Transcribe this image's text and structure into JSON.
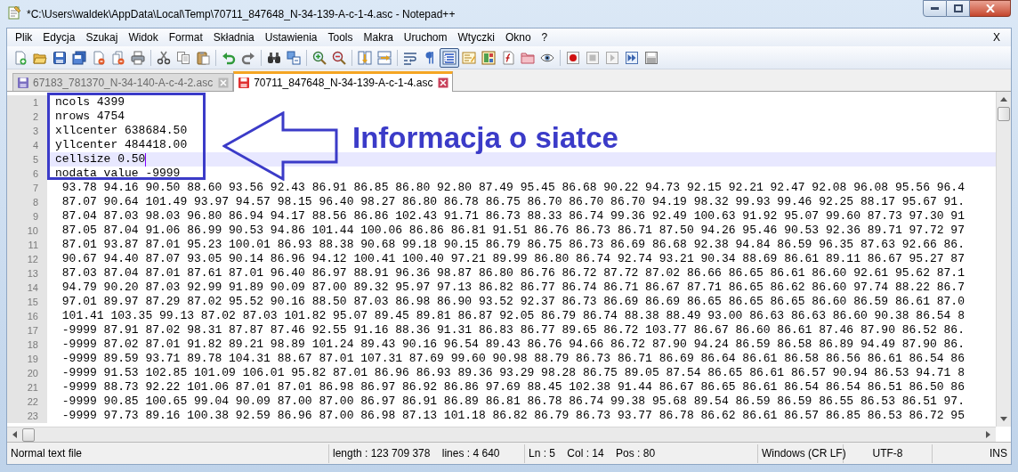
{
  "window": {
    "title": "*C:\\Users\\waldek\\AppData\\Local\\Temp\\70711_847648_N-34-139-A-c-1-4.asc - Notepad++"
  },
  "menu": {
    "items": [
      "Plik",
      "Edycja",
      "Szukaj",
      "Widok",
      "Format",
      "Składnia",
      "Ustawienia",
      "Tools",
      "Makra",
      "Uruchom",
      "Wtyczki",
      "Okno",
      "?"
    ],
    "close_label": "X"
  },
  "toolbar_groups": [
    {
      "buttons": [
        {
          "kind": "new",
          "selected": false
        },
        {
          "kind": "open",
          "selected": false
        },
        {
          "kind": "save",
          "selected": false
        },
        {
          "kind": "saveall",
          "selected": false
        },
        {
          "kind": "close",
          "selected": false
        },
        {
          "kind": "closeall",
          "selected": false
        },
        {
          "kind": "print",
          "selected": false
        }
      ]
    },
    {
      "buttons": [
        {
          "kind": "cut",
          "selected": false
        },
        {
          "kind": "copy",
          "selected": false
        },
        {
          "kind": "paste",
          "selected": false
        }
      ]
    },
    {
      "buttons": [
        {
          "kind": "undo",
          "selected": false
        },
        {
          "kind": "redo",
          "selected": false
        }
      ]
    },
    {
      "buttons": [
        {
          "kind": "find",
          "selected": false
        },
        {
          "kind": "replace",
          "selected": false
        }
      ]
    },
    {
      "buttons": [
        {
          "kind": "zoomin",
          "selected": false
        },
        {
          "kind": "zoomout",
          "selected": false
        }
      ]
    },
    {
      "buttons": [
        {
          "kind": "syncv",
          "selected": false
        },
        {
          "kind": "synch",
          "selected": false
        }
      ]
    },
    {
      "buttons": [
        {
          "kind": "wrap",
          "selected": false
        },
        {
          "kind": "pilcrow",
          "selected": false
        },
        {
          "kind": "indent",
          "selected": true
        },
        {
          "kind": "udl",
          "selected": false
        },
        {
          "kind": "docmap",
          "selected": false
        },
        {
          "kind": "funclist",
          "selected": false
        },
        {
          "kind": "folder",
          "selected": false
        },
        {
          "kind": "monitor",
          "selected": false
        }
      ]
    },
    {
      "buttons": [
        {
          "kind": "record",
          "selected": false
        },
        {
          "kind": "stop",
          "selected": false
        },
        {
          "kind": "play",
          "selected": false
        },
        {
          "kind": "playmulti",
          "selected": false
        },
        {
          "kind": "savemacro",
          "selected": false
        }
      ]
    }
  ],
  "tabs": [
    {
      "label": "67183_781370_N-34-140-A-c-4-2.asc",
      "selected": false,
      "modified": false
    },
    {
      "label": "70711_847648_N-34-139-A-c-1-4.asc",
      "selected": true,
      "modified": true
    }
  ],
  "editor": {
    "lines": [
      {
        "number": "1",
        "text": "ncols 4399",
        "current": false
      },
      {
        "number": "2",
        "text": "nrows 4754",
        "current": false
      },
      {
        "number": "3",
        "text": "xllcenter 638684.50",
        "current": false
      },
      {
        "number": "4",
        "text": "yllcenter 484418.00",
        "current": false
      },
      {
        "number": "5",
        "text": "cellsize 0.50",
        "current": true
      },
      {
        "number": "6",
        "text": "nodata value -9999",
        "current": false
      },
      {
        "number": "7",
        "text": " 93.78 94.16 90.50 88.60 93.56 92.43 86.91 86.85 86.80 92.80 87.49 95.45 86.68 90.22 94.73 92.15 92.21 92.47 92.08 96.08 95.56 96.4",
        "current": false
      },
      {
        "number": "8",
        "text": " 87.07 90.64 101.49 93.97 94.57 98.15 96.40 98.27 86.80 86.78 86.75 86.70 86.70 86.70 94.19 98.32 99.93 99.46 92.25 88.17 95.67 91.",
        "current": false
      },
      {
        "number": "9",
        "text": " 87.04 87.03 98.03 96.80 86.94 94.17 88.56 86.86 102.43 91.71 86.73 88.33 86.74 99.36 92.49 100.63 91.92 95.07 99.60 87.73 97.30 91",
        "current": false
      },
      {
        "number": "10",
        "text": " 87.05 87.04 91.06 86.99 90.53 94.86 101.44 100.06 86.86 86.81 91.51 86.76 86.73 86.71 87.50 94.26 95.46 90.53 92.36 89.71 97.72 97",
        "current": false
      },
      {
        "number": "11",
        "text": " 87.01 93.87 87.01 95.23 100.01 86.93 88.38 90.68 99.18 90.15 86.79 86.75 86.73 86.69 86.68 92.38 94.84 86.59 96.35 87.63 92.66 86.",
        "current": false
      },
      {
        "number": "12",
        "text": " 90.67 94.40 87.07 93.05 90.14 86.96 94.12 100.41 100.40 97.21 89.99 86.80 86.74 92.74 93.21 90.34 88.69 86.61 89.11 86.67 95.27 87",
        "current": false
      },
      {
        "number": "13",
        "text": " 87.03 87.04 87.01 87.61 87.01 96.40 86.97 88.91 96.36 98.87 86.80 86.76 86.72 87.72 87.02 86.66 86.65 86.61 86.60 92.61 95.62 87.1",
        "current": false
      },
      {
        "number": "14",
        "text": " 94.79 90.20 87.03 92.99 91.89 90.09 87.00 89.32 95.97 97.13 86.82 86.77 86.74 86.71 86.67 87.71 86.65 86.62 86.60 97.74 88.22 86.7",
        "current": false
      },
      {
        "number": "15",
        "text": " 97.01 89.97 87.29 87.02 95.52 90.16 88.50 87.03 86.98 86.90 93.52 92.37 86.73 86.69 86.69 86.65 86.65 86.65 86.60 86.59 86.61 87.0",
        "current": false
      },
      {
        "number": "16",
        "text": " 101.41 103.35 99.13 87.02 87.03 101.82 95.07 89.45 89.81 86.87 92.05 86.79 86.74 88.38 88.49 93.00 86.63 86.63 86.60 90.38 86.54 8",
        "current": false
      },
      {
        "number": "17",
        "text": " -9999 87.91 87.02 98.31 87.87 87.46 92.55 91.16 88.36 91.31 86.83 86.77 89.65 86.72 103.77 86.67 86.60 86.61 87.46 87.90 86.52 86.",
        "current": false
      },
      {
        "number": "18",
        "text": " -9999 87.02 87.01 91.82 89.21 98.89 101.24 89.43 90.16 96.54 89.43 86.76 94.66 86.72 87.90 94.24 86.59 86.58 86.89 94.49 87.90 86.",
        "current": false
      },
      {
        "number": "19",
        "text": " -9999 89.59 93.71 89.78 104.31 88.67 87.01 107.31 87.69 99.60 90.98 88.79 86.73 86.71 86.69 86.64 86.61 86.58 86.56 86.61 86.54 86",
        "current": false
      },
      {
        "number": "20",
        "text": " -9999 91.53 102.85 101.09 106.01 95.82 87.01 86.96 86.93 89.36 93.29 98.28 86.75 89.05 87.54 86.65 86.61 86.57 90.94 86.53 94.71 8",
        "current": false
      },
      {
        "number": "21",
        "text": " -9999 88.73 92.22 101.06 87.01 87.01 86.98 86.97 86.92 86.86 97.69 88.45 102.38 91.44 86.67 86.65 86.61 86.54 86.54 86.51 86.50 86",
        "current": false
      },
      {
        "number": "22",
        "text": " -9999 90.85 100.65 99.04 90.09 87.00 87.00 86.97 86.91 86.89 86.81 86.78 86.74 99.38 95.68 89.54 86.59 86.59 86.55 86.53 86.51 97.",
        "current": false
      },
      {
        "number": "23",
        "text": " -9999 97.73 89.16 100.38 92.59 86.96 87.00 86.98 87.13 101.18 86.82 86.79 86.73 93.77 86.78 86.62 86.61 86.57 86.85 86.53 86.72 95",
        "current": false
      }
    ]
  },
  "annotation": {
    "label": "Informacja o siatce"
  },
  "status_bar": [
    "Normal text file",
    "length : 123 709 378    lines : 4 640",
    "Ln : 5    Col : 14    Pos : 80",
    "Windows (CR LF)",
    "UTF-8",
    "INS"
  ]
}
